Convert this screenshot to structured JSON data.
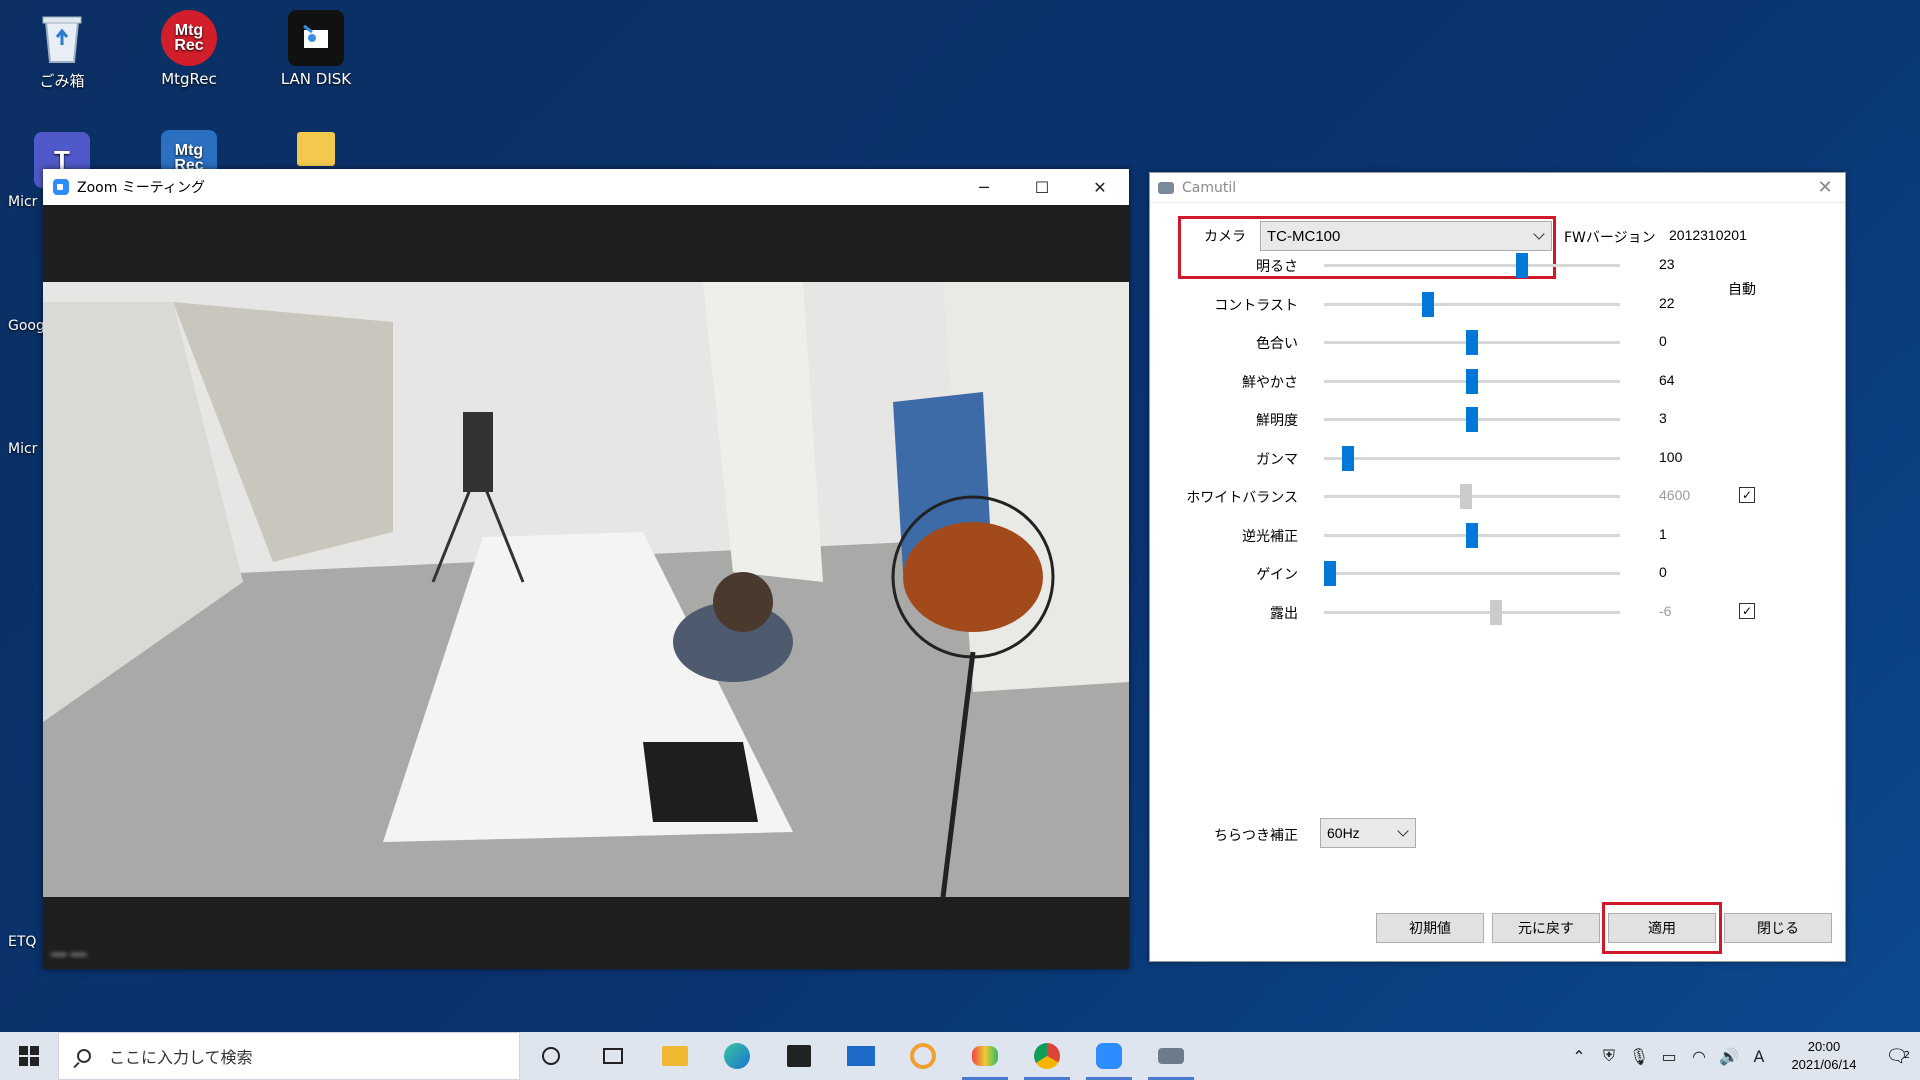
{
  "desktop": {
    "icons": [
      {
        "label": "ごみ箱"
      },
      {
        "label": "MtgRec"
      },
      {
        "label": "LAN DISK"
      }
    ],
    "edge_labels": [
      "Micr",
      "Goog",
      "Micr",
      "ETQ"
    ]
  },
  "zoom": {
    "title": "Zoom ミーティング"
  },
  "camutil": {
    "title": "Camutil",
    "camera_label": "カメラ",
    "camera_value": "TC-MC100",
    "fw_label": "FWバージョン",
    "fw_value": "2012310201",
    "auto_label": "自動",
    "sliders": [
      {
        "label": "明るさ",
        "value": "23",
        "fraction": 0.67,
        "disabled": false,
        "auto": null
      },
      {
        "label": "コントラスト",
        "value": "22",
        "fraction": 0.35,
        "disabled": false,
        "auto": null
      },
      {
        "label": "色合い",
        "value": "0",
        "fraction": 0.5,
        "disabled": false,
        "auto": null
      },
      {
        "label": "鮮やかさ",
        "value": "64",
        "fraction": 0.5,
        "disabled": false,
        "auto": null
      },
      {
        "label": "鮮明度",
        "value": "3",
        "fraction": 0.5,
        "disabled": false,
        "auto": null
      },
      {
        "label": "ガンマ",
        "value": "100",
        "fraction": 0.08,
        "disabled": false,
        "auto": null
      },
      {
        "label": "ホワイトバランス",
        "value": "4600",
        "fraction": 0.48,
        "disabled": true,
        "auto": true
      },
      {
        "label": "逆光補正",
        "value": "1",
        "fraction": 0.5,
        "disabled": false,
        "auto": null
      },
      {
        "label": "ゲイン",
        "value": "0",
        "fraction": 0.02,
        "disabled": false,
        "auto": null
      },
      {
        "label": "露出",
        "value": "-6",
        "fraction": 0.58,
        "disabled": true,
        "auto": true
      }
    ],
    "flicker_label": "ちらつき補正",
    "flicker_value": "60Hz",
    "buttons": {
      "defaults": "初期値",
      "revert": "元に戻す",
      "apply": "適用",
      "close": "閉じる"
    },
    "highlight_color": "#d0182a",
    "accent_color": "#0078d7"
  },
  "taskbar": {
    "search_placeholder": "ここに入力して検索",
    "ime": "A",
    "time": "20:00",
    "date": "2021/06/14",
    "notification_count": "2"
  }
}
